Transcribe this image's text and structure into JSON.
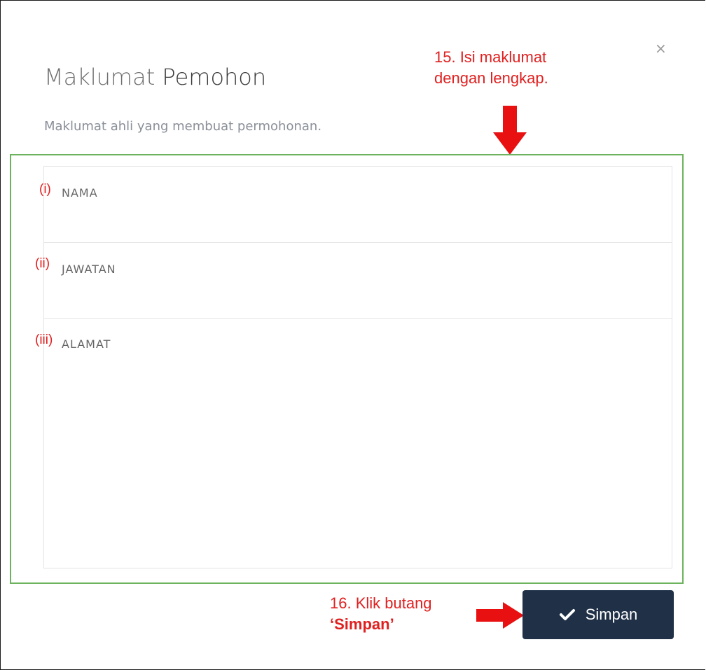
{
  "modal": {
    "close_label": "×",
    "title_prefix": "Maklumat",
    "title_strong": "Pemohon",
    "subtitle": "Maklumat ahli yang membuat permohonan."
  },
  "form": {
    "fields": [
      {
        "marker": "(i)",
        "label": "NAMA",
        "value": ""
      },
      {
        "marker": "(ii)",
        "label": "JAWATAN",
        "value": ""
      },
      {
        "marker": "(iii)",
        "label": "ALAMAT",
        "value": ""
      }
    ]
  },
  "annotations": {
    "step15_line1": "15. Isi maklumat",
    "step15_line2": "dengan lengkap.",
    "step16_line1": "16. Klik butang",
    "step16_line2": "‘Simpan’"
  },
  "actions": {
    "save_label": "Simpan",
    "save_icon": "check-icon"
  },
  "colors": {
    "annotation": "#e02020",
    "highlight_border": "#6db35e",
    "button_bg": "#1f3047"
  }
}
